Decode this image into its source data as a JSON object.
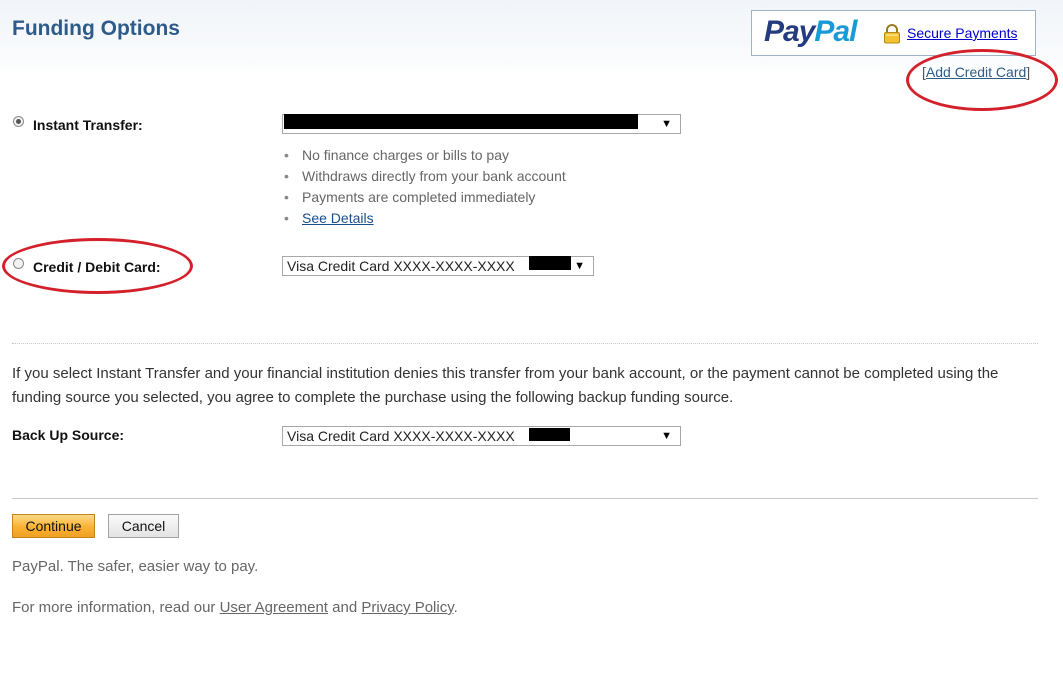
{
  "header": {
    "title": "Funding Options",
    "paypal_logo": {
      "pay": "Pay",
      "pal": "Pal"
    },
    "secure_payments_label": "Secure Payments",
    "add_credit_card_label": "Add Credit Card"
  },
  "funding": {
    "instant_transfer": {
      "label": "Instant Transfer:",
      "selected": true,
      "selected_value": "",
      "benefits": [
        "No finance charges or bills to pay",
        "Withdraws directly from your bank account",
        "Payments are completed immediately"
      ],
      "details_link": "See Details"
    },
    "card": {
      "label": "Credit / Debit Card:",
      "selected": false,
      "selected_value": "Visa Credit Card XXXX-XXXX-XXXX"
    }
  },
  "notice_text": "If you select Instant Transfer and your financial institution denies this transfer from your bank account, or the payment cannot be completed using the funding source you selected, you agree to complete the purchase using the following backup funding source.",
  "backup": {
    "label": "Back Up Source:",
    "selected_value": "Visa Credit Card XXXX-XXXX-XXXX"
  },
  "actions": {
    "continue_label": "Continue",
    "cancel_label": "Cancel"
  },
  "footer": {
    "tagline": "PayPal. The safer, easier way to pay.",
    "more_info_prefix": "For more information, read our ",
    "user_agreement": "User Agreement",
    "and": " and ",
    "privacy_policy": "Privacy Policy",
    "suffix": "."
  },
  "colors": {
    "title": "#2d5b8a",
    "paypal_navy": "#253b80",
    "paypal_blue": "#179bd7",
    "annotation_red": "#d4202a",
    "continue_button": "#f9b233"
  },
  "icons": {
    "lock": "lock-icon",
    "dropdown": "chevron-down-icon"
  }
}
